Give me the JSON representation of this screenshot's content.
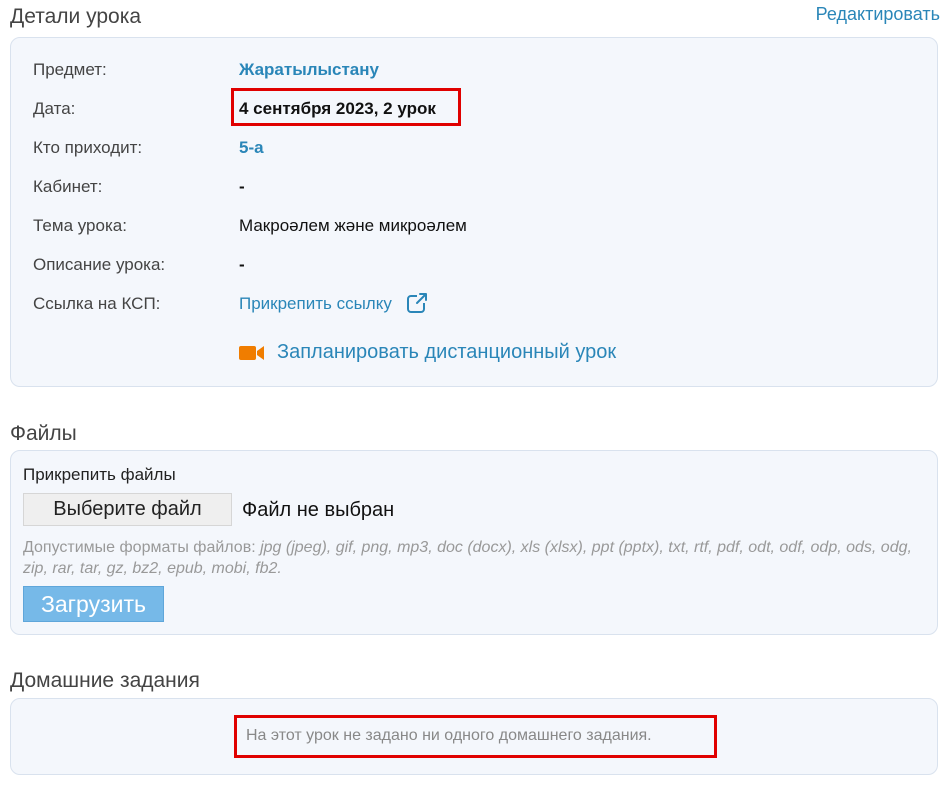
{
  "details": {
    "title": "Детали урока",
    "edit_label": "Редактировать",
    "rows": [
      {
        "label": "Предмет:",
        "value": "Жаратылыстану"
      },
      {
        "label": "Дата:",
        "value": "4 сентября 2023, 2 урок"
      },
      {
        "label": "Кто приходит:",
        "value": "5-а"
      },
      {
        "label": "Кабинет:",
        "value": "-"
      },
      {
        "label": "Тема урока:",
        "value": "Макроәлем және микроәлем"
      },
      {
        "label": "Описание урока:",
        "value": "-"
      },
      {
        "label": "Ссылка на КСП:",
        "value": "Прикрепить ссылку"
      }
    ],
    "remote_lesson_label": "Запланировать дистанционный урок"
  },
  "files": {
    "title": "Файлы",
    "attach_title": "Прикрепить файлы",
    "choose_button": "Выберите файл",
    "no_file": "Файл не выбран",
    "formats_prefix": "Допустимые форматы файлов: ",
    "formats_list": "jpg (jpeg), gif, png, mp3, doc (docx), xls (xlsx), ppt (pptx), txt, rtf, pdf, odt, odf, odp, ods, odg, zip, rar, tar, gz, bz2, epub, mobi, fb2.",
    "upload_button": "Загрузить"
  },
  "homework": {
    "title": "Домашние задания",
    "empty_text": "На этот урок не задано ни одного домашнего задания."
  },
  "colors": {
    "link": "#2a86b8",
    "highlight": "#e00000",
    "camera": "#f07d00"
  },
  "icons": {
    "external_link": "external-link-icon",
    "camera": "video-camera-icon"
  }
}
